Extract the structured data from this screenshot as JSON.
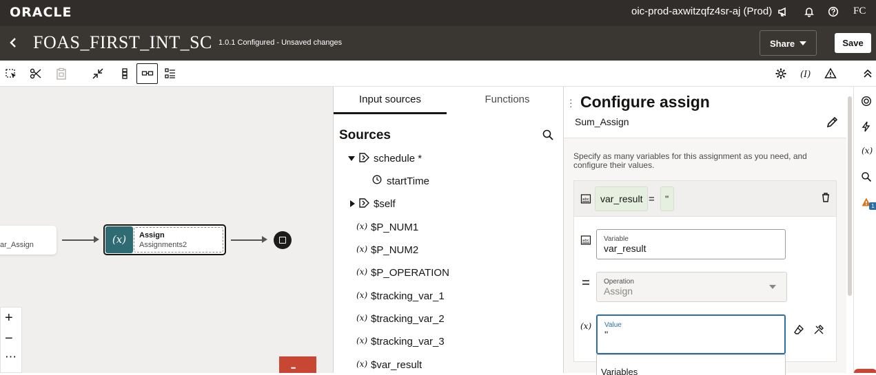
{
  "header": {
    "logo": "ORACLE",
    "instance": "oic-prod-axwitzqfz4sr-aj (Prod)",
    "user_initials": "FC"
  },
  "titlebar": {
    "integration_name": "FOAS_FIRST_INT_SC",
    "version_status": "1.0.1 Configured - Unsaved changes",
    "share_label": "Share",
    "save_label": "Save"
  },
  "canvas": {
    "prev_node_label": "ar_Assign",
    "assign_node": {
      "icon": "(x)",
      "title": "Assign",
      "subtitle": "Assignments2"
    },
    "zoom_in": "+",
    "zoom_out": "−",
    "more": "⋯"
  },
  "sources_panel": {
    "tabs": [
      "Input sources",
      "Functions"
    ],
    "heading": "Sources",
    "items": [
      {
        "label": "schedule *",
        "kind": "group-open"
      },
      {
        "label": "startTime",
        "kind": "time"
      },
      {
        "label": "$self",
        "kind": "group-closed"
      },
      {
        "label": "$P_NUM1",
        "kind": "var"
      },
      {
        "label": "$P_NUM2",
        "kind": "var"
      },
      {
        "label": "$P_OPERATION",
        "kind": "var"
      },
      {
        "label": "$tracking_var_1",
        "kind": "var"
      },
      {
        "label": "$tracking_var_2",
        "kind": "var"
      },
      {
        "label": "$tracking_var_3",
        "kind": "var"
      },
      {
        "label": "$var_result",
        "kind": "var"
      }
    ],
    "var_icon": "(x)"
  },
  "configure": {
    "title": "Configure assign",
    "name": "Sum_Assign",
    "description": "Specify as many variables for this assignment as you need, and configure their values.",
    "summary": {
      "variable": "var_result",
      "equals": "=",
      "value": "''"
    },
    "variable_field": {
      "label": "Variable",
      "value": "var_result"
    },
    "operation_field": {
      "label": "Operation",
      "value": "Assign"
    },
    "value_field": {
      "label": "Value",
      "value": "''"
    },
    "value_icon": "(x)",
    "dropdown_first": "Variables"
  },
  "rail": {
    "badge_count": "1",
    "var_icon": "(x)"
  }
}
